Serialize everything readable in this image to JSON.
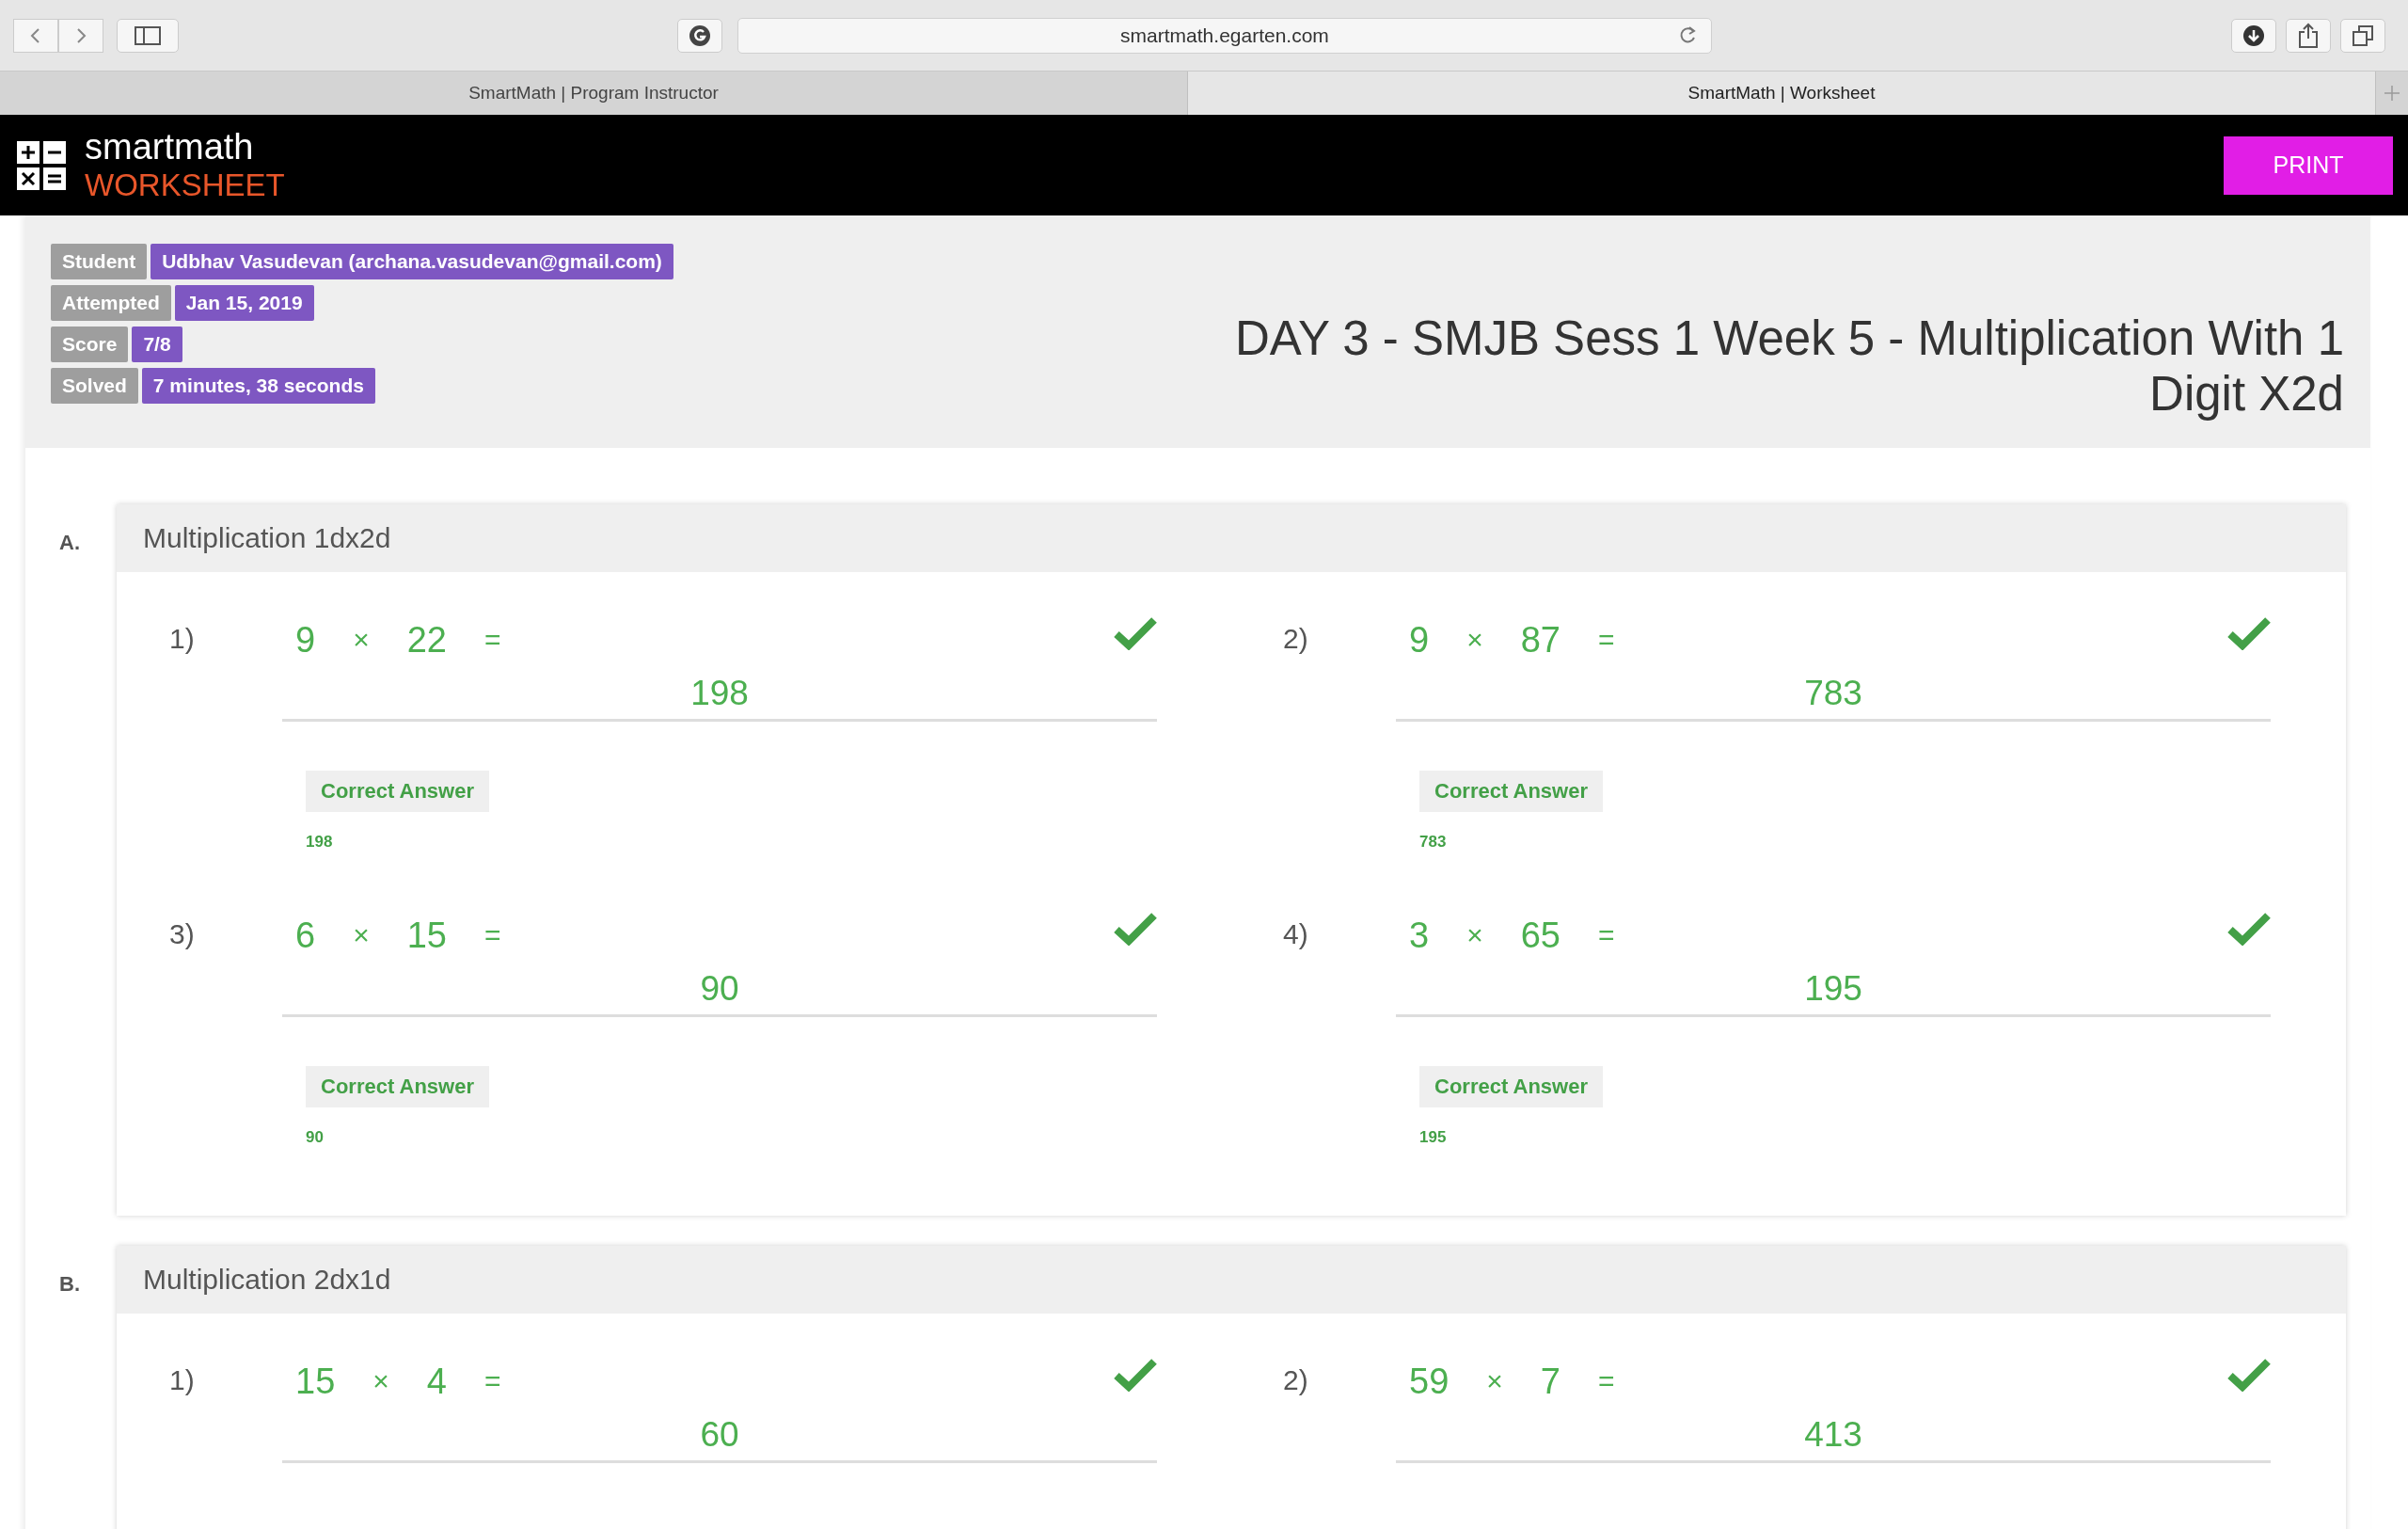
{
  "browser": {
    "url": "smartmath.egarten.com",
    "tabs": [
      {
        "title": "SmartMath | Program Instructor",
        "selected": false
      },
      {
        "title": "SmartMath | Worksheet",
        "selected": true
      }
    ]
  },
  "header": {
    "brand": "smartmath",
    "subtitle": "WORKSHEET",
    "print_button": "PRINT"
  },
  "info": [
    {
      "label": "Student",
      "value": "Udbhav Vasudevan (archana.vasudevan@gmail.com)"
    },
    {
      "label": "Attempted",
      "value": "Jan 15, 2019"
    },
    {
      "label": "Score",
      "value": "7/8"
    },
    {
      "label": "Solved",
      "value": "7 minutes, 38 seconds"
    }
  ],
  "title": "DAY 3 - SMJB Sess 1 Week 5 - Multiplication With 1 Digit X2d",
  "sections": [
    {
      "letter": "A.",
      "name": "Multiplication 1dx2d",
      "problems": [
        {
          "number": "1)",
          "a": "9",
          "op": "×",
          "b": "22",
          "eq": "=",
          "answer": "198",
          "correct": true,
          "correct_label": "Correct Answer",
          "correct_value": "198"
        },
        {
          "number": "2)",
          "a": "9",
          "op": "×",
          "b": "87",
          "eq": "=",
          "answer": "783",
          "correct": true,
          "correct_label": "Correct Answer",
          "correct_value": "783"
        },
        {
          "number": "3)",
          "a": "6",
          "op": "×",
          "b": "15",
          "eq": "=",
          "answer": "90",
          "correct": true,
          "correct_label": "Correct Answer",
          "correct_value": "90"
        },
        {
          "number": "4)",
          "a": "3",
          "op": "×",
          "b": "65",
          "eq": "=",
          "answer": "195",
          "correct": true,
          "correct_label": "Correct Answer",
          "correct_value": "195"
        }
      ]
    },
    {
      "letter": "B.",
      "name": "Multiplication 2dx1d",
      "problems": [
        {
          "number": "1)",
          "a": "15",
          "op": "×",
          "b": "4",
          "eq": "=",
          "answer": "60",
          "correct": true
        },
        {
          "number": "2)",
          "a": "59",
          "op": "×",
          "b": "7",
          "eq": "=",
          "answer": "413",
          "correct": true
        }
      ]
    }
  ]
}
